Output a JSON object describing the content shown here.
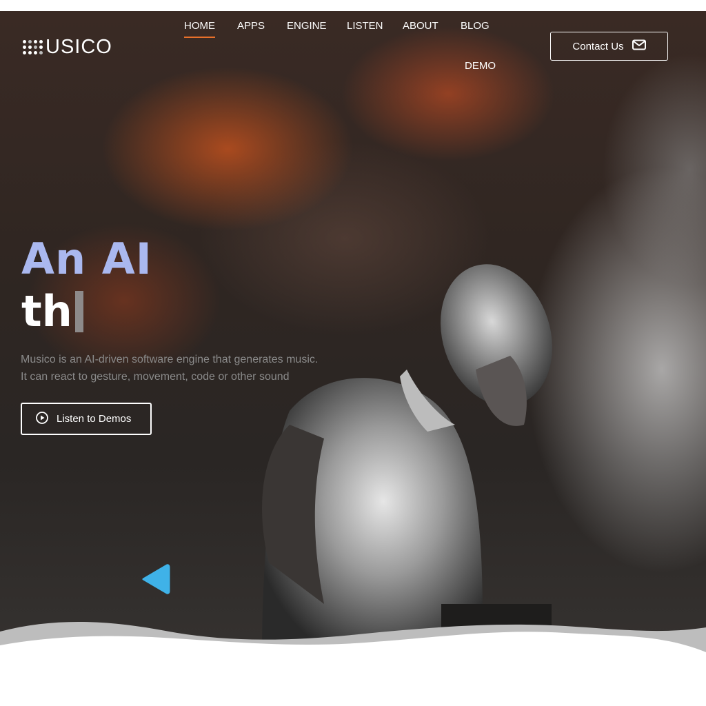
{
  "brand": {
    "logo_text": "USICO"
  },
  "nav": {
    "items": [
      {
        "label": "HOME",
        "active": true
      },
      {
        "label": "APPS"
      },
      {
        "label": "ENGINE"
      },
      {
        "label": "LISTEN"
      },
      {
        "label": "ABOUT"
      },
      {
        "label": "BLOG"
      },
      {
        "label": "DEMO"
      }
    ],
    "active_underline_color": "#e8702a"
  },
  "header": {
    "contact_label": "Contact Us",
    "contact_icon": "envelope-icon"
  },
  "hero": {
    "headline_line1": "An AI",
    "headline_line2": "th",
    "description_line1": "Musico is an AI-driven software engine that generates music.",
    "description_line2": "It can react to gesture, movement, code or other sound",
    "cta_label": "Listen to Demos",
    "cta_icon": "play-circle-icon"
  },
  "colors": {
    "headline_accent": "#aab8ef",
    "triangle": "#3fb2e8"
  }
}
